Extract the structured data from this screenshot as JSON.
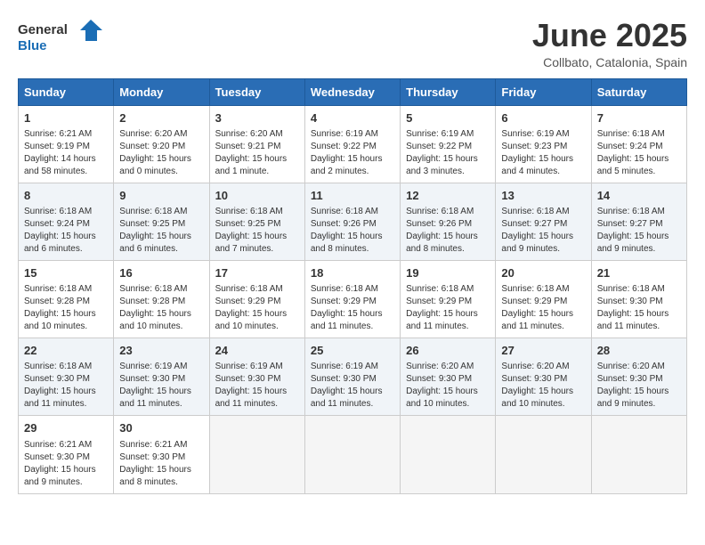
{
  "logo": {
    "general": "General",
    "blue": "Blue"
  },
  "title": "June 2025",
  "subtitle": "Collbato, Catalonia, Spain",
  "days_of_week": [
    "Sunday",
    "Monday",
    "Tuesday",
    "Wednesday",
    "Thursday",
    "Friday",
    "Saturday"
  ],
  "weeks": [
    [
      {
        "day": 1,
        "sunrise": "6:21 AM",
        "sunset": "9:19 PM",
        "daylight": "14 hours and 58 minutes."
      },
      {
        "day": 2,
        "sunrise": "6:20 AM",
        "sunset": "9:20 PM",
        "daylight": "15 hours and 0 minutes."
      },
      {
        "day": 3,
        "sunrise": "6:20 AM",
        "sunset": "9:21 PM",
        "daylight": "15 hours and 1 minute."
      },
      {
        "day": 4,
        "sunrise": "6:19 AM",
        "sunset": "9:22 PM",
        "daylight": "15 hours and 2 minutes."
      },
      {
        "day": 5,
        "sunrise": "6:19 AM",
        "sunset": "9:22 PM",
        "daylight": "15 hours and 3 minutes."
      },
      {
        "day": 6,
        "sunrise": "6:19 AM",
        "sunset": "9:23 PM",
        "daylight": "15 hours and 4 minutes."
      },
      {
        "day": 7,
        "sunrise": "6:18 AM",
        "sunset": "9:24 PM",
        "daylight": "15 hours and 5 minutes."
      }
    ],
    [
      {
        "day": 8,
        "sunrise": "6:18 AM",
        "sunset": "9:24 PM",
        "daylight": "15 hours and 6 minutes."
      },
      {
        "day": 9,
        "sunrise": "6:18 AM",
        "sunset": "9:25 PM",
        "daylight": "15 hours and 6 minutes."
      },
      {
        "day": 10,
        "sunrise": "6:18 AM",
        "sunset": "9:25 PM",
        "daylight": "15 hours and 7 minutes."
      },
      {
        "day": 11,
        "sunrise": "6:18 AM",
        "sunset": "9:26 PM",
        "daylight": "15 hours and 8 minutes."
      },
      {
        "day": 12,
        "sunrise": "6:18 AM",
        "sunset": "9:26 PM",
        "daylight": "15 hours and 8 minutes."
      },
      {
        "day": 13,
        "sunrise": "6:18 AM",
        "sunset": "9:27 PM",
        "daylight": "15 hours and 9 minutes."
      },
      {
        "day": 14,
        "sunrise": "6:18 AM",
        "sunset": "9:27 PM",
        "daylight": "15 hours and 9 minutes."
      }
    ],
    [
      {
        "day": 15,
        "sunrise": "6:18 AM",
        "sunset": "9:28 PM",
        "daylight": "15 hours and 10 minutes."
      },
      {
        "day": 16,
        "sunrise": "6:18 AM",
        "sunset": "9:28 PM",
        "daylight": "15 hours and 10 minutes."
      },
      {
        "day": 17,
        "sunrise": "6:18 AM",
        "sunset": "9:29 PM",
        "daylight": "15 hours and 10 minutes."
      },
      {
        "day": 18,
        "sunrise": "6:18 AM",
        "sunset": "9:29 PM",
        "daylight": "15 hours and 11 minutes."
      },
      {
        "day": 19,
        "sunrise": "6:18 AM",
        "sunset": "9:29 PM",
        "daylight": "15 hours and 11 minutes."
      },
      {
        "day": 20,
        "sunrise": "6:18 AM",
        "sunset": "9:29 PM",
        "daylight": "15 hours and 11 minutes."
      },
      {
        "day": 21,
        "sunrise": "6:18 AM",
        "sunset": "9:30 PM",
        "daylight": "15 hours and 11 minutes."
      }
    ],
    [
      {
        "day": 22,
        "sunrise": "6:18 AM",
        "sunset": "9:30 PM",
        "daylight": "15 hours and 11 minutes."
      },
      {
        "day": 23,
        "sunrise": "6:19 AM",
        "sunset": "9:30 PM",
        "daylight": "15 hours and 11 minutes."
      },
      {
        "day": 24,
        "sunrise": "6:19 AM",
        "sunset": "9:30 PM",
        "daylight": "15 hours and 11 minutes."
      },
      {
        "day": 25,
        "sunrise": "6:19 AM",
        "sunset": "9:30 PM",
        "daylight": "15 hours and 11 minutes."
      },
      {
        "day": 26,
        "sunrise": "6:20 AM",
        "sunset": "9:30 PM",
        "daylight": "15 hours and 10 minutes."
      },
      {
        "day": 27,
        "sunrise": "6:20 AM",
        "sunset": "9:30 PM",
        "daylight": "15 hours and 10 minutes."
      },
      {
        "day": 28,
        "sunrise": "6:20 AM",
        "sunset": "9:30 PM",
        "daylight": "15 hours and 9 minutes."
      }
    ],
    [
      {
        "day": 29,
        "sunrise": "6:21 AM",
        "sunset": "9:30 PM",
        "daylight": "15 hours and 9 minutes."
      },
      {
        "day": 30,
        "sunrise": "6:21 AM",
        "sunset": "9:30 PM",
        "daylight": "15 hours and 8 minutes."
      },
      null,
      null,
      null,
      null,
      null
    ]
  ]
}
